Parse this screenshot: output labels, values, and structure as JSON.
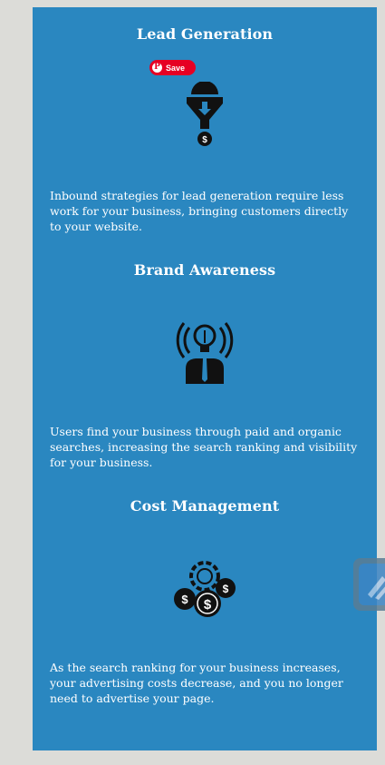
{
  "sections": [
    {
      "title": "Lead Generation",
      "icon": "funnel-gear-icon",
      "text": "Inbound strategies for lead generation require less work for your business, bringing customers directly to your website."
    },
    {
      "title": "Brand Awareness",
      "icon": "lightbulb-broadcast-icon",
      "text": "Users find your business through paid and organic searches, increasing the search ranking and visibility for your business."
    },
    {
      "title": "Cost Management",
      "icon": "gear-dollar-coins-icon",
      "text": "As the search ranking for your business increases, your advertising costs decrease, and you no longer need to advertise your page."
    }
  ],
  "pinterest": {
    "label": "Save"
  },
  "colors": {
    "panel": "#2a87c0",
    "background": "#dcdcd8",
    "pinterest": "#e60023"
  }
}
